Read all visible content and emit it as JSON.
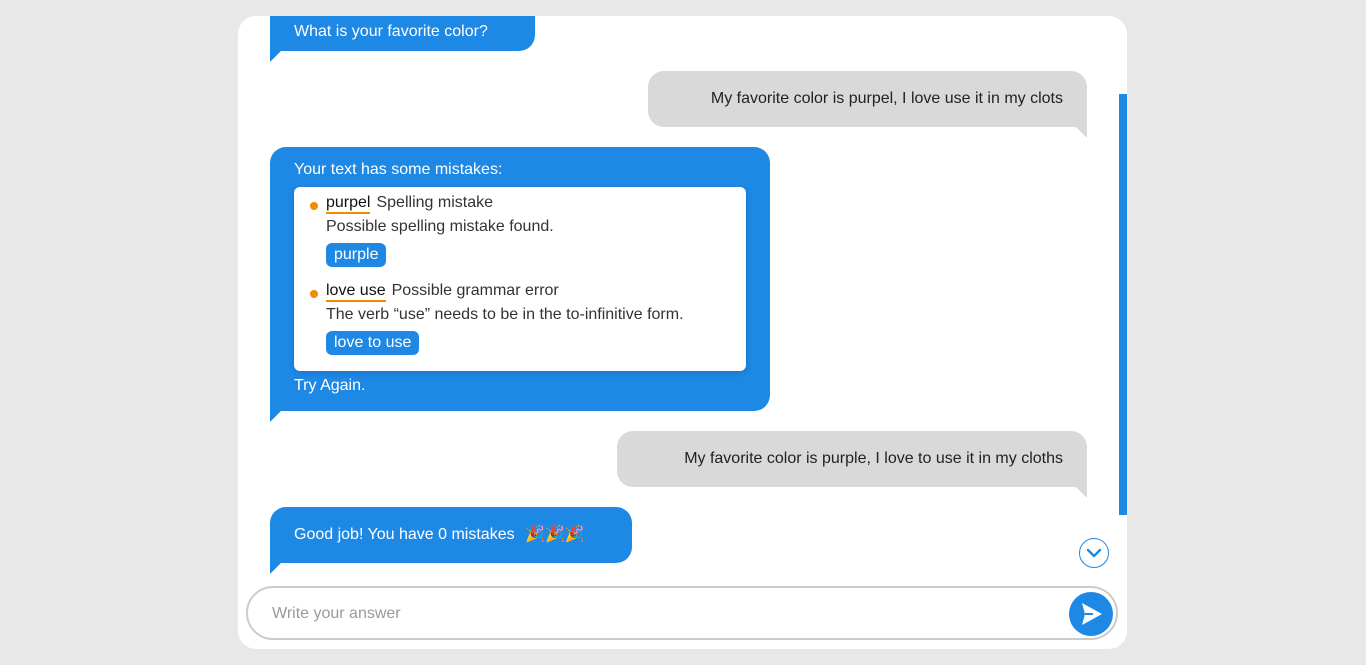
{
  "messages": [
    {
      "sender": "bot",
      "text": "What is your favorite color?"
    },
    {
      "sender": "user",
      "text": "My favorite color is purpel, I love use it in my clots"
    },
    {
      "sender": "bot",
      "intro": "Your text has some mistakes:",
      "mistakes": [
        {
          "word": "purpel",
          "type": "Spelling mistake",
          "description": "Possible spelling mistake found.",
          "suggestion": "purple"
        },
        {
          "word": "love use",
          "type": "Possible grammar error",
          "description": "The verb “use” needs to be in the to-infinitive form.",
          "suggestion": "love to use"
        }
      ],
      "outro": "Try Again."
    },
    {
      "sender": "user",
      "text": "My favorite color is purple, I love to use it in my cloths"
    },
    {
      "sender": "bot",
      "text": "Good job! You have 0 mistakes",
      "emoji": "🎉🎉🎉"
    }
  ],
  "input": {
    "placeholder": "Write your answer",
    "value": ""
  },
  "icons": {
    "scroll_down": "chevron-down-icon",
    "send": "send-arrow-icon",
    "celebration": "party-popper-icon"
  },
  "colors": {
    "accent": "#1e88e5",
    "user_bubble": "#d9d9d9",
    "mistake_underline": "#f08c00",
    "background": "#e8e8e8"
  }
}
